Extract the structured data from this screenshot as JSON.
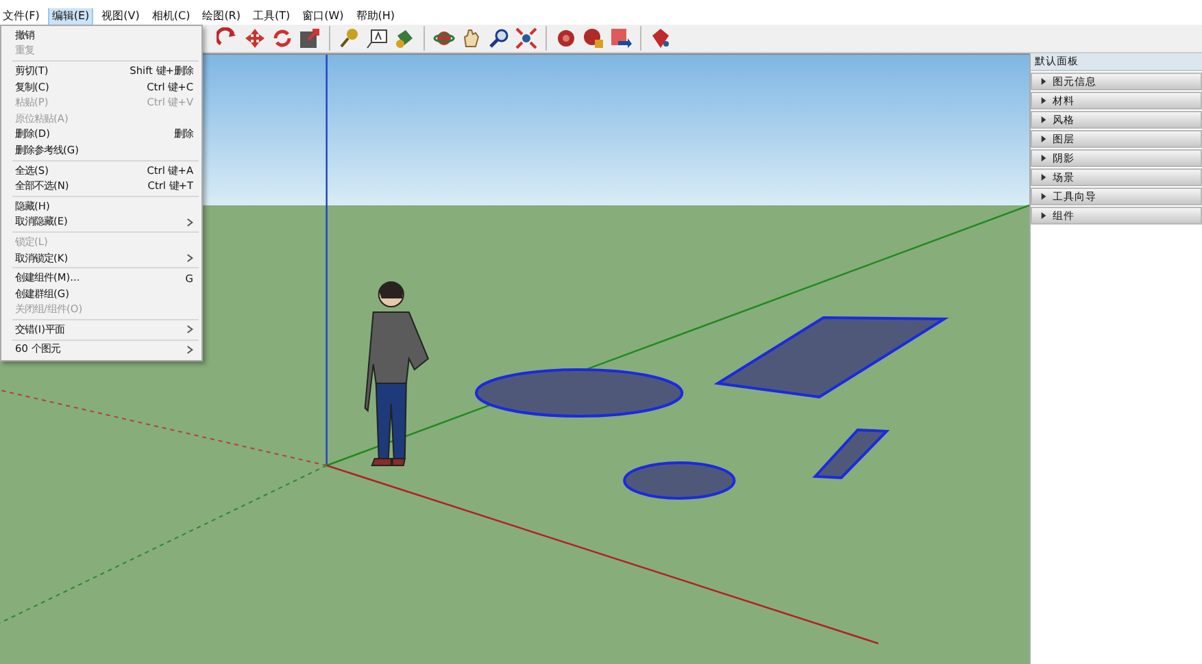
{
  "menu_bar": [
    {
      "label": "文件(F)",
      "selected": false
    },
    {
      "label": "编辑(E)",
      "selected": true
    },
    {
      "label": "视图(V)",
      "selected": false
    },
    {
      "label": "相机(C)",
      "selected": false
    },
    {
      "label": "绘图(R)",
      "selected": false
    },
    {
      "label": "工具(T)",
      "selected": false
    },
    {
      "label": "窗口(W)",
      "selected": false
    },
    {
      "label": "帮助(H)",
      "selected": false
    }
  ],
  "edit_menu": [
    {
      "kind": "item",
      "label": "撤销",
      "disabled": false
    },
    {
      "kind": "item",
      "label": "重复",
      "disabled": true
    },
    {
      "kind": "separator"
    },
    {
      "kind": "item",
      "label": "剪切(T)",
      "shortcut": "Shift 键+删除",
      "disabled": false
    },
    {
      "kind": "item",
      "label": "复制(C)",
      "shortcut": "Ctrl 键+C",
      "disabled": false
    },
    {
      "kind": "item",
      "label": "粘贴(P)",
      "shortcut": "Ctrl 键+V",
      "disabled": true
    },
    {
      "kind": "item",
      "label": "原位粘贴(A)",
      "disabled": true
    },
    {
      "kind": "item",
      "label": "删除(D)",
      "shortcut": "删除",
      "disabled": false
    },
    {
      "kind": "item",
      "label": "删除参考线(G)",
      "disabled": false
    },
    {
      "kind": "separator"
    },
    {
      "kind": "item",
      "label": "全选(S)",
      "shortcut": "Ctrl 键+A",
      "disabled": false
    },
    {
      "kind": "item",
      "label": "全部不选(N)",
      "shortcut": "Ctrl 键+T",
      "disabled": false
    },
    {
      "kind": "separator"
    },
    {
      "kind": "item",
      "label": "隐藏(H)",
      "disabled": false
    },
    {
      "kind": "item",
      "label": "取消隐藏(E)",
      "submenu": true,
      "disabled": false
    },
    {
      "kind": "separator"
    },
    {
      "kind": "item",
      "label": "锁定(L)",
      "disabled": true
    },
    {
      "kind": "item",
      "label": "取消锁定(K)",
      "submenu": true,
      "disabled": false
    },
    {
      "kind": "separator"
    },
    {
      "kind": "item",
      "label": "创建组件(M)...",
      "shortcut": "G",
      "disabled": false
    },
    {
      "kind": "item",
      "label": "创建群组(G)",
      "disabled": false
    },
    {
      "kind": "item",
      "label": "关闭组/组件(O)",
      "disabled": true
    },
    {
      "kind": "separator"
    },
    {
      "kind": "item",
      "label": "交错(I)平面",
      "submenu": true,
      "disabled": false
    },
    {
      "kind": "separator"
    },
    {
      "kind": "item",
      "label": "60 个图元",
      "submenu": true,
      "disabled": false
    }
  ],
  "tray": {
    "title": "默认面板",
    "sections": [
      {
        "label": "图元信息",
        "expanded": false
      },
      {
        "label": "材料",
        "expanded": false
      },
      {
        "label": "风格",
        "expanded": false
      },
      {
        "label": "图层",
        "expanded": false
      },
      {
        "label": "阴影",
        "expanded": false
      },
      {
        "label": "场景",
        "expanded": false
      },
      {
        "label": "工具向导",
        "expanded": false
      },
      {
        "label": "组件",
        "expanded": false
      }
    ]
  }
}
